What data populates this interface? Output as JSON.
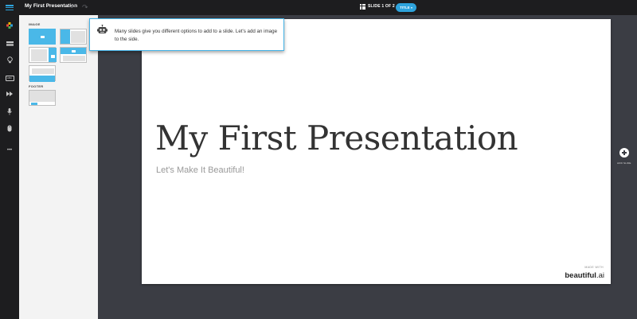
{
  "app": {
    "title": "My First Presentation",
    "slide_indicator": "SLIDE 1 OF 2",
    "layout_button": "TITLE",
    "accent_color": "#2ea3dc"
  },
  "sidebar": {
    "tools": [
      "menu-icon",
      "theme-icon",
      "layout-icon",
      "bulb-icon",
      "text-icon",
      "forward-icon",
      "microphone-icon",
      "mouse-icon",
      "more-icon"
    ],
    "text_tool_label": "ABC",
    "more_label": "•••"
  },
  "panel": {
    "section_image": "IMAGE",
    "section_footer": "FOOTER"
  },
  "tooltip": {
    "text": "Many slides give you different options to add to a slide. Let's add an image to the side."
  },
  "slide": {
    "title": "My First Presentation",
    "subtitle": "Let's Make It Beautiful!",
    "made_with": "MADE WITH",
    "brand_main": "beautiful",
    "brand_suffix": ".ai"
  },
  "stage": {
    "add_slide_label": "ADD SLIDE"
  }
}
